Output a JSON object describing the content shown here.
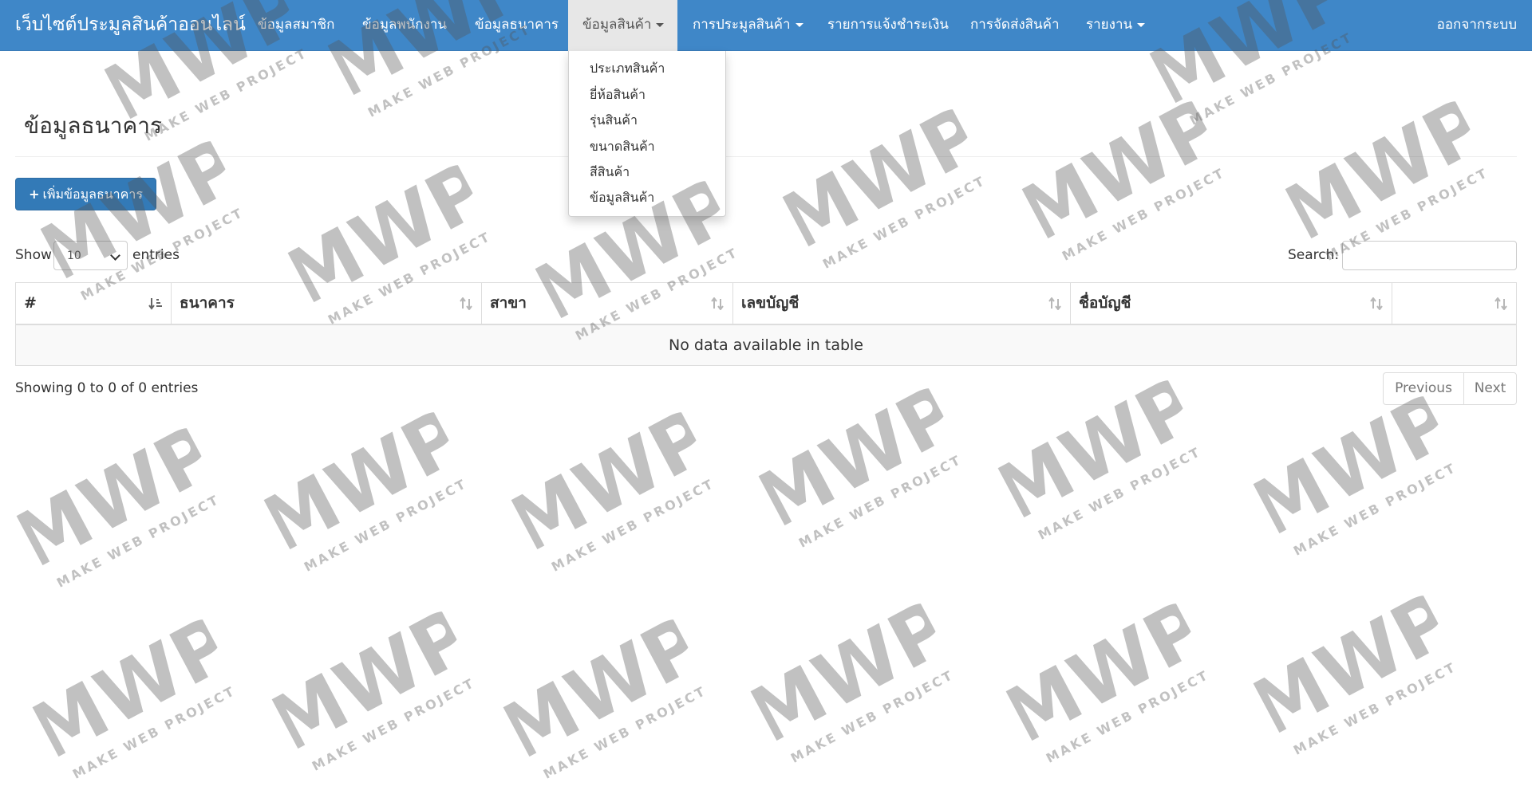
{
  "navbar": {
    "brand": "เว็บไซต์ประมูลสินค้าออนไลน์",
    "items": [
      {
        "label": "ข้อมูลสมาชิก"
      },
      {
        "label": "ข้อมูลพนักงาน"
      },
      {
        "label": "ข้อมูลธนาคาร"
      },
      {
        "label": "ข้อมูลสินค้า"
      },
      {
        "label": "การประมูลสินค้า"
      },
      {
        "label": "รายการแจ้งชำระเงิน"
      },
      {
        "label": "การจัดส่งสินค้า"
      },
      {
        "label": "รายงาน"
      }
    ],
    "logout": "ออกจากระบบ"
  },
  "dropdown": {
    "items": [
      "ประเภทสินค้า",
      "ยี่ห้อสินค้า",
      "รุ่นสินค้า",
      "ขนาดสินค้า",
      "สีสินค้า",
      "ข้อมูลสินค้า"
    ]
  },
  "page": {
    "title": "ข้อมูลธนาคาร",
    "add_button": "เพิ่มข้อมูลธนาคาร"
  },
  "table_controls": {
    "show_label": "Show",
    "entries_value": "10",
    "entries_label": "entries",
    "search_label": "Search:",
    "search_value": ""
  },
  "table": {
    "columns": [
      "#",
      "ธนาคาร",
      "สาขา",
      "เลขบัญชี",
      "ชื่อบัญชี",
      ""
    ],
    "empty_text": "No data available in table"
  },
  "footer": {
    "info": "Showing 0 to 0 of 0 entries",
    "previous": "Previous",
    "next": "Next"
  },
  "watermark": {
    "logo_text": "MWP",
    "tagline": "MAKE WEB PROJECT"
  },
  "colors": {
    "navbar_bg": "#3f87c8",
    "primary_button": "#337ab7",
    "active_nav_bg": "#e7e7e7"
  }
}
